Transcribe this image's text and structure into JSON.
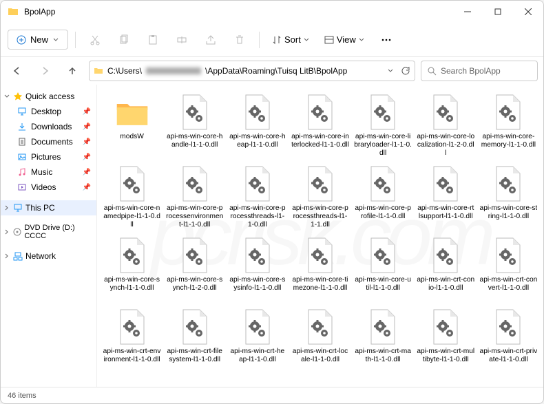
{
  "window": {
    "title": "BpolApp"
  },
  "toolbar": {
    "new": "New",
    "sort": "Sort",
    "view": "View"
  },
  "address": {
    "path_prefix": "C:\\Users\\",
    "path_suffix": "\\AppData\\Roaming\\Tuisq LitB\\BpolApp"
  },
  "search": {
    "placeholder": "Search BpolApp"
  },
  "sidebar": {
    "quick": "Quick access",
    "items": [
      {
        "icon": "desktop",
        "label": "Desktop"
      },
      {
        "icon": "downloads",
        "label": "Downloads"
      },
      {
        "icon": "documents",
        "label": "Documents"
      },
      {
        "icon": "pictures",
        "label": "Pictures"
      },
      {
        "icon": "music",
        "label": "Music"
      },
      {
        "icon": "videos",
        "label": "Videos"
      }
    ],
    "thispc": "This PC",
    "dvd": "DVD Drive (D:) CCCC",
    "network": "Network"
  },
  "files": [
    {
      "type": "folder",
      "name": "modsW"
    },
    {
      "type": "dll",
      "name": "api-ms-win-core-handle-l1-1-0.dll"
    },
    {
      "type": "dll",
      "name": "api-ms-win-core-heap-l1-1-0.dll"
    },
    {
      "type": "dll",
      "name": "api-ms-win-core-interlocked-l1-1-0.dll"
    },
    {
      "type": "dll",
      "name": "api-ms-win-core-libraryloader-l1-1-0.dll"
    },
    {
      "type": "dll",
      "name": "api-ms-win-core-localization-l1-2-0.dll"
    },
    {
      "type": "dll",
      "name": "api-ms-win-core-memory-l1-1-0.dll"
    },
    {
      "type": "dll",
      "name": "api-ms-win-core-namedpipe-l1-1-0.dll"
    },
    {
      "type": "dll",
      "name": "api-ms-win-core-processenvironment-l1-1-0.dll"
    },
    {
      "type": "dll",
      "name": "api-ms-win-core-processthreads-l1-1-0.dll"
    },
    {
      "type": "dll",
      "name": "api-ms-win-core-processthreads-l1-1-1.dll"
    },
    {
      "type": "dll",
      "name": "api-ms-win-core-profile-l1-1-0.dll"
    },
    {
      "type": "dll",
      "name": "api-ms-win-core-rtlsupport-l1-1-0.dll"
    },
    {
      "type": "dll",
      "name": "api-ms-win-core-string-l1-1-0.dll"
    },
    {
      "type": "dll",
      "name": "api-ms-win-core-synch-l1-1-0.dll"
    },
    {
      "type": "dll",
      "name": "api-ms-win-core-synch-l1-2-0.dll"
    },
    {
      "type": "dll",
      "name": "api-ms-win-core-sysinfo-l1-1-0.dll"
    },
    {
      "type": "dll",
      "name": "api-ms-win-core-timezone-l1-1-0.dll"
    },
    {
      "type": "dll",
      "name": "api-ms-win-core-util-l1-1-0.dll"
    },
    {
      "type": "dll",
      "name": "api-ms-win-crt-conio-l1-1-0.dll"
    },
    {
      "type": "dll",
      "name": "api-ms-win-crt-convert-l1-1-0.dll"
    },
    {
      "type": "dll",
      "name": "api-ms-win-crt-environment-l1-1-0.dll"
    },
    {
      "type": "dll",
      "name": "api-ms-win-crt-filesystem-l1-1-0.dll"
    },
    {
      "type": "dll",
      "name": "api-ms-win-crt-heap-l1-1-0.dll"
    },
    {
      "type": "dll",
      "name": "api-ms-win-crt-locale-l1-1-0.dll"
    },
    {
      "type": "dll",
      "name": "api-ms-win-crt-math-l1-1-0.dll"
    },
    {
      "type": "dll",
      "name": "api-ms-win-crt-multibyte-l1-1-0.dll"
    },
    {
      "type": "dll",
      "name": "api-ms-win-crt-private-l1-1-0.dll"
    }
  ],
  "status": {
    "count": "46 items"
  },
  "watermark": "pcrisk.com"
}
